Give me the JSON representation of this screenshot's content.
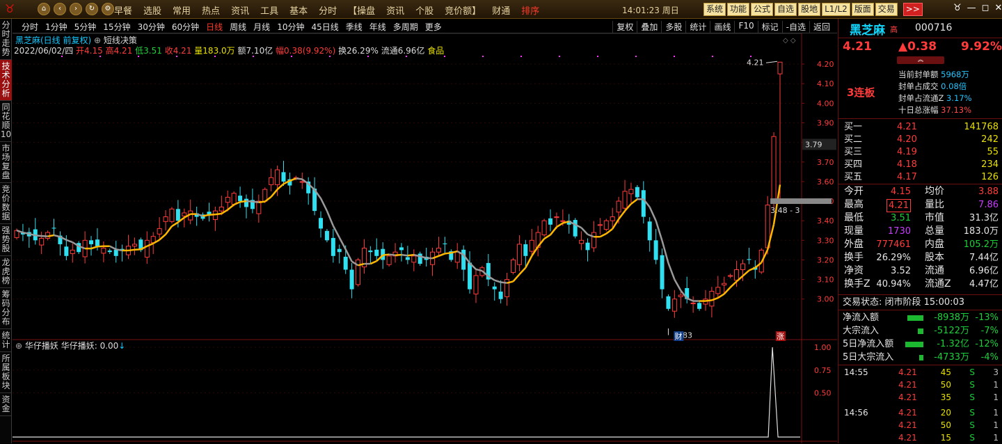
{
  "topbar": {
    "menu": [
      "早餐",
      "选股",
      "常用",
      "热点",
      "资讯",
      "工具",
      "基本",
      "分时",
      "【操盘",
      "资讯",
      "个股",
      "竞价额】",
      "财通",
      "排序"
    ],
    "menu_active": "排序",
    "clock": "14:01:23 周日",
    "buttons": [
      "系统",
      "功能",
      "公式",
      "自选",
      "股地",
      "L1/L2",
      "版面",
      "交易"
    ],
    "more": ">>"
  },
  "leftnav": [
    "分时走势",
    "技术分析",
    "同花顺10",
    "市场复盘",
    "竞价数据",
    "强势股",
    "龙虎榜",
    "筹码分布",
    "统计",
    "所属板块",
    "资金"
  ],
  "leftnav_active": "技术分析",
  "chartbar": {
    "periods": [
      "分时",
      "1分钟",
      "5分钟",
      "15分钟",
      "30分钟",
      "60分钟",
      "日线",
      "周线",
      "月线",
      "10分钟",
      "45日线",
      "季线",
      "年线",
      "多周期",
      "更多"
    ],
    "active": "日线",
    "tools": [
      "复权",
      "叠加",
      "多股",
      "统计",
      "画线",
      "F10",
      "标记",
      "-自选",
      "返回"
    ]
  },
  "info": {
    "stock": "黑芝麻(日线 前复权)",
    "indicator": "短线决策",
    "date": "2022/06/02/四",
    "open": "开4.15",
    "high": "高4.21",
    "low": "低3.51",
    "close": "收4.21",
    "vol": "量183.0万",
    "amt": "额7.10亿",
    "range": "幅0.38(9.92%)",
    "turnover": "换26.29%",
    "float": "流通6.96亿",
    "sector": "食品"
  },
  "chart_labels": {
    "high_mark": "4.21",
    "low_mark": "2.83",
    "price_cursor": "3.79",
    "mid_label": "3.48 - 3",
    "fin_badge": "财",
    "zhang_badge": "涨"
  },
  "yaxis": [
    "4.20",
    "4.10",
    "4.00",
    "3.90",
    "3.80",
    "3.70",
    "3.60",
    "3.50",
    "3.40",
    "3.30",
    "3.20",
    "3.10",
    "3.00"
  ],
  "indicator": {
    "title": "华仔播妖  华仔播妖: 0.00",
    "yaxis": [
      "1.00",
      "0.75",
      "0.50"
    ]
  },
  "side": {
    "name": "黑芝麻",
    "tag": "高",
    "code": "000716",
    "price": "4.21",
    "change": "▲0.38",
    "pct": "9.92%",
    "board": "3连板",
    "seal": [
      {
        "label": "当前封单额",
        "value": "5968万",
        "cls": "v"
      },
      {
        "label": "封单占成交",
        "value": "0.08倍",
        "cls": "v"
      },
      {
        "label": "封单占流通Z",
        "value": "3.17%",
        "cls": "v"
      },
      {
        "label": "十日总涨幅",
        "value": "37.13%",
        "cls": "r"
      }
    ],
    "bids": [
      {
        "label": "买一",
        "price": "4.21",
        "vol": "141768"
      },
      {
        "label": "买二",
        "price": "4.20",
        "vol": "242"
      },
      {
        "label": "买三",
        "price": "4.19",
        "vol": "55"
      },
      {
        "label": "买四",
        "price": "4.18",
        "vol": "234"
      },
      {
        "label": "买五",
        "price": "4.17",
        "vol": "126"
      }
    ],
    "stats": [
      {
        "l1": "今开",
        "v1": "4.15",
        "c1": "#ff3b3b",
        "l2": "均价",
        "v2": "3.88",
        "c2": "#ff3b3b"
      },
      {
        "l1": "最高",
        "v1": "4.21",
        "c1": "#ff3b3b",
        "l2": "量比",
        "v2": "7.86",
        "c2": "#c83cff"
      },
      {
        "l1": "最低",
        "v1": "3.51",
        "c1": "#1cd03c",
        "l2": "市值",
        "v2": "31.3亿",
        "c2": "#e6e6e6"
      },
      {
        "l1": "现量",
        "v1": "1730",
        "c1": "#c83cff",
        "l2": "总量",
        "v2": "183.0万",
        "c2": "#e6e6e6"
      },
      {
        "l1": "外盘",
        "v1": "777461",
        "c1": "#ff3b3b",
        "l2": "内盘",
        "v2": "105.2万",
        "c2": "#1cd03c"
      },
      {
        "l1": "换手",
        "v1": "26.29%",
        "c1": "#e6e6e6",
        "l2": "股本",
        "v2": "7.44亿",
        "c2": "#e6e6e6"
      },
      {
        "l1": "净资",
        "v1": "3.52",
        "c1": "#e6e6e6",
        "l2": "流通",
        "v2": "6.96亿",
        "c2": "#e6e6e6"
      },
      {
        "l1": "换手Z",
        "v1": "40.94%",
        "c1": "#e6e6e6",
        "l2": "流通Z",
        "v2": "4.47亿",
        "c2": "#e6e6e6"
      }
    ],
    "status": "交易状态: 闭市阶段 15:00:03",
    "flows": [
      {
        "label": "净流入额",
        "bar": 0.9,
        "value": "-8938万",
        "pct": "-13%"
      },
      {
        "label": "大宗流入",
        "bar": 0.3,
        "value": "-5122万",
        "pct": "-7%"
      },
      {
        "label": "5日净流入额",
        "bar": 1.0,
        "value": "-1.32亿",
        "pct": "-12%"
      },
      {
        "label": "5日大宗流入",
        "bar": 0.25,
        "value": "-4733万",
        "pct": "-4%"
      }
    ],
    "trades": [
      {
        "time": "14:55",
        "price": "4.21",
        "vol": "45",
        "side": "S",
        "n": "3"
      },
      {
        "time": "",
        "price": "4.21",
        "vol": "50",
        "side": "S",
        "n": "1"
      },
      {
        "time": "",
        "price": "4.21",
        "vol": "35",
        "side": "S",
        "n": "1"
      },
      {
        "time": "14:56",
        "price": "4.21",
        "vol": "20",
        "side": "S",
        "n": "1"
      },
      {
        "time": "",
        "price": "4.21",
        "vol": "50",
        "side": "S",
        "n": "1"
      },
      {
        "time": "",
        "price": "4.21",
        "vol": "15",
        "side": "S",
        "n": "1"
      }
    ]
  },
  "chart_data": {
    "type": "candlestick",
    "last": {
      "open": 4.15,
      "high": 4.21,
      "low": 3.51,
      "close": 4.21
    },
    "ylim": [
      2.8,
      4.25
    ],
    "closes": [
      3.35,
      3.33,
      3.32,
      3.3,
      3.31,
      3.34,
      3.36,
      3.28,
      3.22,
      3.25,
      3.24,
      3.3,
      3.28,
      3.27,
      3.26,
      3.24,
      3.22,
      3.25,
      3.27,
      3.28,
      3.25,
      3.3,
      3.32,
      3.36,
      3.42,
      3.46,
      3.4,
      3.44,
      3.45,
      3.42,
      3.41,
      3.43,
      3.45,
      3.47,
      3.52,
      3.54,
      3.5,
      3.47,
      3.46,
      3.5,
      3.56,
      3.62,
      3.66,
      3.6,
      3.58,
      3.62,
      3.6,
      3.54,
      3.45,
      3.36,
      3.3,
      3.22,
      3.24,
      3.15,
      3.05,
      3.2,
      3.26,
      3.24,
      3.22,
      3.2,
      3.22,
      3.24,
      3.25,
      3.2,
      3.22,
      3.18,
      3.2,
      3.24,
      3.26,
      3.28,
      3.2,
      3.24,
      3.15,
      3.05,
      3.12,
      3.16,
      3.1,
      3.05,
      3.0,
      3.1,
      3.2,
      3.28,
      3.22,
      3.3,
      3.34,
      3.4,
      3.38,
      3.42,
      3.4,
      3.38,
      3.32,
      3.3,
      3.25,
      3.34,
      3.38,
      3.4,
      3.42,
      3.5,
      3.55,
      3.56,
      3.52,
      3.42,
      3.3,
      3.2,
      3.05,
      2.95,
      3.0,
      3.02,
      3.0,
      2.98,
      2.95,
      3.0,
      3.04,
      3.06,
      3.08,
      3.12,
      3.15,
      3.18,
      3.2,
      3.15,
      3.25,
      3.48,
      3.83,
      4.21
    ]
  }
}
